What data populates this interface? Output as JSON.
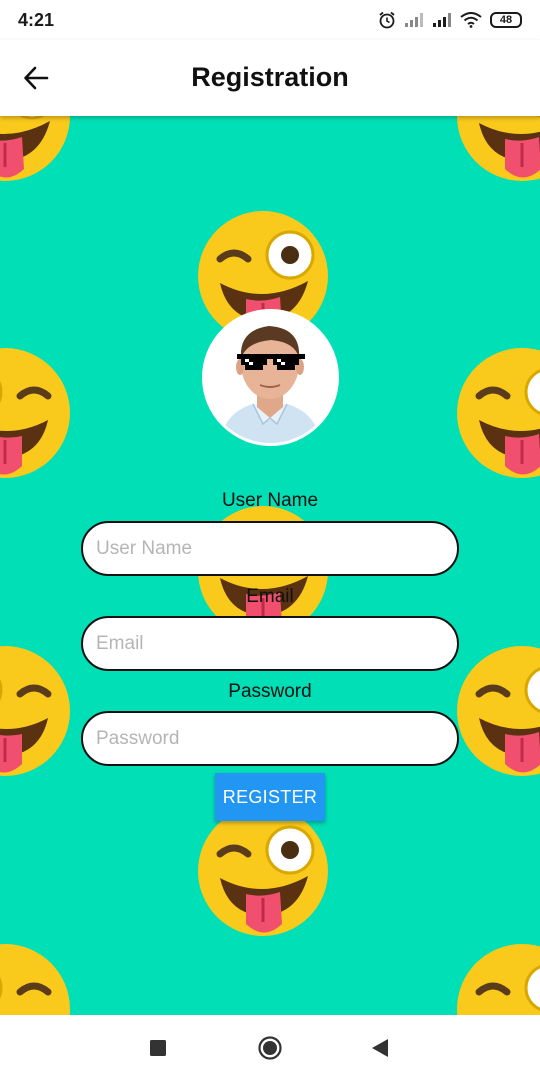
{
  "status_bar": {
    "time": "4:21",
    "battery": "48",
    "icons": [
      "alarm-icon",
      "signal-icon",
      "signal-icon",
      "wifi-icon",
      "battery-icon"
    ]
  },
  "app_bar": {
    "title": "Registration",
    "back_icon": "arrow-left-icon"
  },
  "background": {
    "color": "#00dfb6",
    "pattern": "winking-tongue-emoji"
  },
  "avatar": {
    "icon": "profile-photo-with-pixel-sunglasses"
  },
  "form": {
    "username": {
      "label": "User Name",
      "placeholder": "User Name",
      "value": ""
    },
    "email": {
      "label": "Email",
      "placeholder": "Email",
      "value": ""
    },
    "password": {
      "label": "Password",
      "placeholder": "Password",
      "value": ""
    },
    "register_label": "REGISTER"
  },
  "colors": {
    "accent": "#2196f3",
    "background": "#00dfb6",
    "emoji_face": "#f9c91b",
    "tongue": "#f0506e"
  },
  "nav_bar": {
    "icons": [
      "square-recents-icon",
      "circle-home-icon",
      "triangle-back-icon"
    ]
  }
}
